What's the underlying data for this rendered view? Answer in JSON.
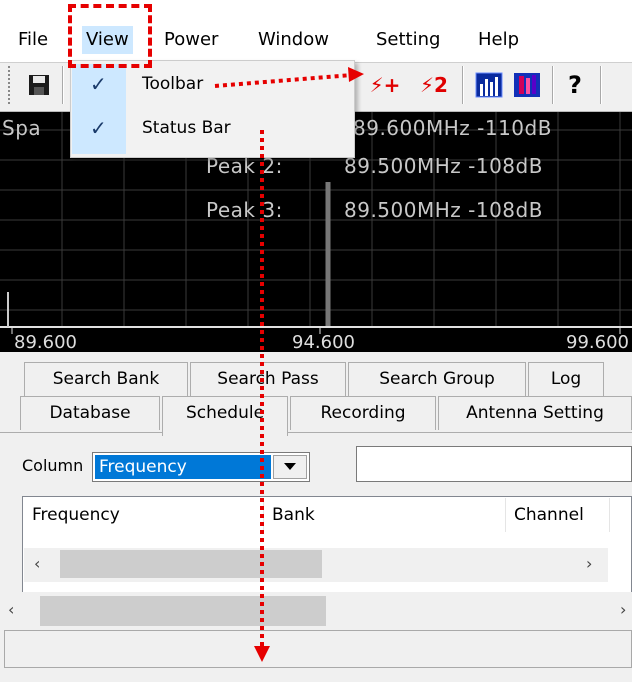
{
  "menubar": {
    "items": [
      "File",
      "View",
      "Power",
      "Window",
      "Setting",
      "Help"
    ]
  },
  "view_menu": {
    "items": [
      {
        "label": "Toolbar",
        "checked": true,
        "check": "✓"
      },
      {
        "label": "Status Bar",
        "checked": true,
        "check": "✓"
      }
    ]
  },
  "toolbar": {
    "buttons": [
      {
        "icon": "save-icon",
        "glyph": "■"
      },
      {
        "icon": "add-peak-icon",
        "glyph": "⚡+"
      },
      {
        "icon": "peak-2-icon",
        "glyph": "⚡2"
      },
      {
        "icon": "spectrum-bars-icon"
      },
      {
        "icon": "waterfall-icon"
      },
      {
        "icon": "help-icon",
        "glyph": "?"
      }
    ]
  },
  "spectrum": {
    "span_label": "Spa",
    "peak_1_value": "89.600MHz -110dB",
    "peaks": [
      {
        "label": "Peak 2:",
        "value": "89.500MHz -108dB"
      },
      {
        "label": "Peak 3:",
        "value": "89.500MHz -108dB"
      }
    ],
    "axis": [
      "89.600",
      "94.600",
      "99.600"
    ]
  },
  "tabs": {
    "row1": [
      "Search Bank",
      "Search Pass",
      "Search Group",
      "Log"
    ],
    "row2": [
      "Database",
      "Schedule",
      "Recording",
      "Antenna Setting"
    ]
  },
  "column_filter": {
    "label": "Column",
    "selected": "Frequency",
    "search_value": ""
  },
  "list": {
    "headers": [
      "Frequency",
      "Bank",
      "Channel"
    ]
  },
  "colors": {
    "highlight_box": "#e60000",
    "arrow": "#e60000",
    "selection": "#0078d7",
    "menu_check_gutter": "#cde8ff",
    "spectrum_bg": "#000000"
  }
}
